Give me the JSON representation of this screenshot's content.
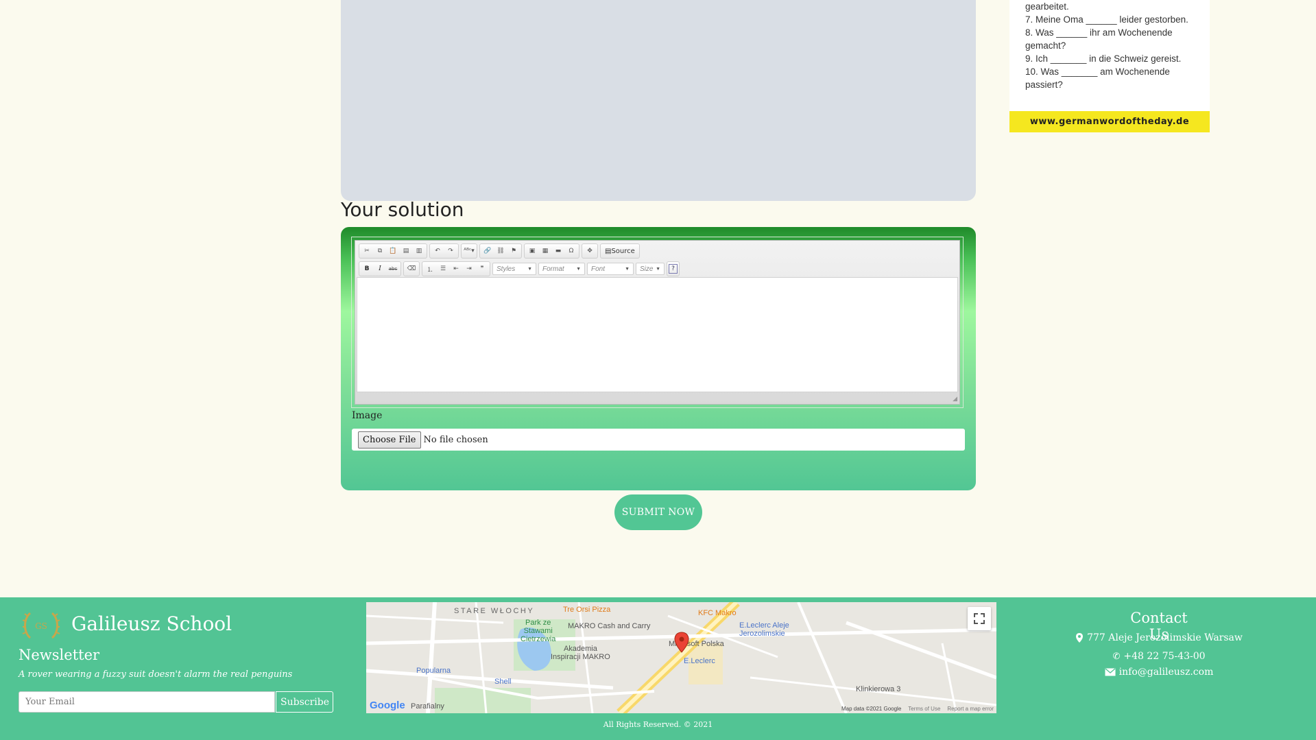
{
  "worksheet": {
    "lines": [
      "gearbeitet.",
      "7. Meine Oma ______ leider gestorben.",
      "8. Was ______ ihr am Wochenende",
      "gemacht?",
      "9. Ich _______ in die Schweiz gereist.",
      "10. Was _______ am Wochenende",
      "passiert?"
    ],
    "footer_url": "www.germanwordoftheday.de"
  },
  "solution": {
    "title": "Your solution",
    "toolbar": {
      "source_label": "Source",
      "styles_placeholder": "Styles",
      "format_placeholder": "Format",
      "font_placeholder": "Font",
      "size_placeholder": "Size",
      "bold": "B",
      "italic": "I",
      "strike": "abc",
      "quote": "❞",
      "help": "?"
    },
    "image_label": "Image",
    "file_button": "Choose File",
    "file_status": "No file chosen",
    "submit_label": "SUBMIT NOW"
  },
  "footer": {
    "brand": "Galileusz School",
    "logo_text": "GS",
    "newsletter_title": "Newsletter",
    "newsletter_text": "A rover wearing a fuzzy suit doesn't alarm the real penguins",
    "email_placeholder": "Your Email",
    "subscribe_label": "Subscribe",
    "map": {
      "labels": {
        "stare_wlochy": "STARE WŁOCHY",
        "tre_orsi": "Tre Orsi Pizza",
        "kfc": "KFC Makro",
        "park": "Park ze\nStawami\nCietrzewia",
        "makro": "MAKRO Cash and Carry",
        "leclerc_aleje": "E.Leclerc Aleje\nJerozolimskie",
        "akademia": "Akademia\nInspiracji MAKRO",
        "microsoft": "Microsoft Polska",
        "leclerc": "E.Leclerc",
        "popularna": "Popularna",
        "shell": "Shell",
        "klinikierowa": "Klinkierowa 3",
        "parafialny": "Parafialny"
      },
      "attribution": "Map data ©2021 Google",
      "terms": "Terms of Use",
      "report": "Report a map error",
      "google": "Google"
    },
    "contact": {
      "title": "Contact Us",
      "address": "777 Aleje Jerozolimskie Warsaw",
      "phone": "+48 22 75-43-00",
      "email": "info@galileusz.com"
    },
    "copyright": "All Rights Reserved. © 2021"
  }
}
